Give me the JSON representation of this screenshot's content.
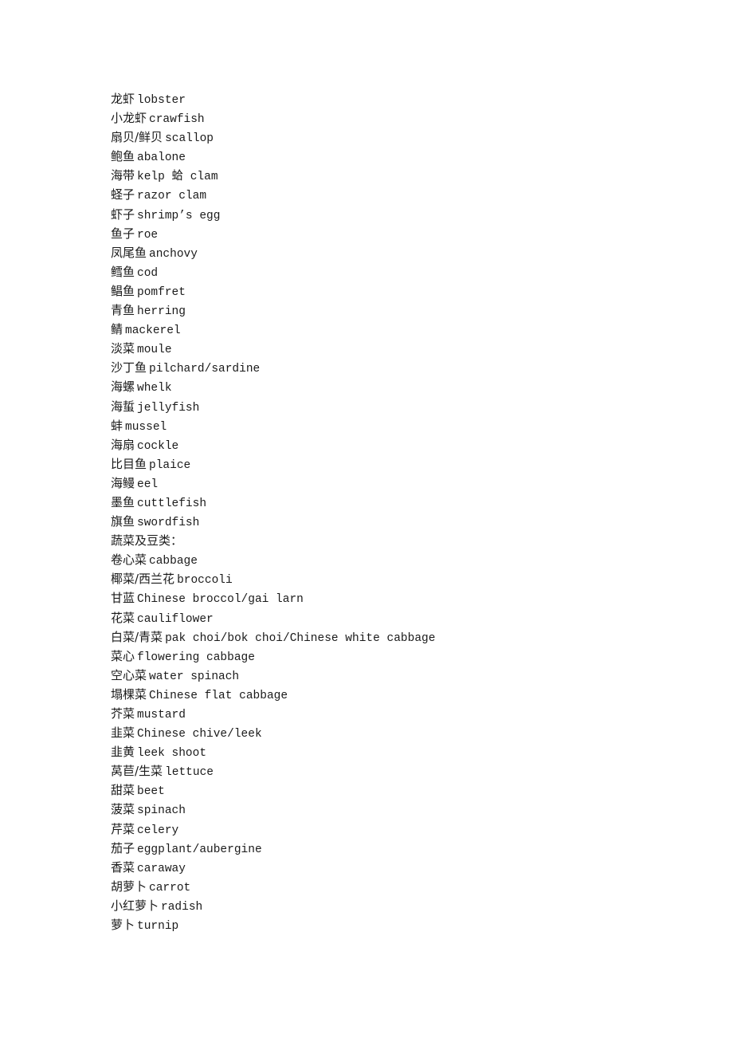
{
  "document": {
    "lines": [
      {
        "zh": "龙虾",
        "en": "lobster"
      },
      {
        "zh": "小龙虾",
        "en": "crawfish"
      },
      {
        "zh": "扇贝/鲜贝",
        "en": "scallop"
      },
      {
        "zh": "鲍鱼",
        "en": "abalone"
      },
      {
        "zh": "海带",
        "en": "kelp 蛤 clam"
      },
      {
        "zh": "蛏子",
        "en": "razor clam"
      },
      {
        "zh": "虾子",
        "en": "shrimp’s egg"
      },
      {
        "zh": "鱼子",
        "en": "roe"
      },
      {
        "zh": "凤尾鱼",
        "en": "anchovy"
      },
      {
        "zh": "鳕鱼",
        "en": "cod"
      },
      {
        "zh": "鲳鱼",
        "en": "pomfret"
      },
      {
        "zh": "青鱼",
        "en": "herring"
      },
      {
        "zh": "鲭",
        "en": "mackerel"
      },
      {
        "zh": "淡菜",
        "en": "moule"
      },
      {
        "zh": "沙丁鱼",
        "en": "pilchard/sardine"
      },
      {
        "zh": "海螺",
        "en": "whelk"
      },
      {
        "zh": "海蜇",
        "en": "jellyfish"
      },
      {
        "zh": "蚌",
        "en": "mussel"
      },
      {
        "zh": "海扇",
        "en": "cockle"
      },
      {
        "zh": "比目鱼",
        "en": "plaice"
      },
      {
        "zh": "海鳗",
        "en": "eel"
      },
      {
        "zh": "墨鱼",
        "en": "cuttlefish"
      },
      {
        "zh": "旗鱼",
        "en": "swordfish"
      },
      {
        "zh": "蔬菜及豆类：",
        "en": ""
      },
      {
        "zh": "卷心菜",
        "en": "cabbage"
      },
      {
        "zh": "椰菜/西兰花",
        "en": "broccoli"
      },
      {
        "zh": "甘蓝",
        "en": "Chinese broccol/gai larn"
      },
      {
        "zh": "花菜",
        "en": "cauliflower"
      },
      {
        "zh": "白菜/青菜",
        "en": "pak choi/bok choi/Chinese white cabbage"
      },
      {
        "zh": "菜心",
        "en": "flowering cabbage"
      },
      {
        "zh": "空心菜",
        "en": "water spinach"
      },
      {
        "zh": "塌棵菜",
        "en": "Chinese flat cabbage"
      },
      {
        "zh": "芥菜",
        "en": "mustard"
      },
      {
        "zh": "韭菜",
        "en": "Chinese chive/leek"
      },
      {
        "zh": "韭黄",
        "en": "leek shoot"
      },
      {
        "zh": "莴苣/生菜",
        "en": "lettuce"
      },
      {
        "zh": "甜菜",
        "en": "beet"
      },
      {
        "zh": "菠菜",
        "en": "spinach"
      },
      {
        "zh": "芹菜",
        "en": "celery"
      },
      {
        "zh": "茄子",
        "en": "eggplant/aubergine"
      },
      {
        "zh": "香菜",
        "en": "caraway"
      },
      {
        "zh": "胡萝卜",
        "en": "carrot"
      },
      {
        "zh": "小红萝卜",
        "en": "radish"
      },
      {
        "zh": "萝卜",
        "en": "turnip"
      }
    ]
  }
}
